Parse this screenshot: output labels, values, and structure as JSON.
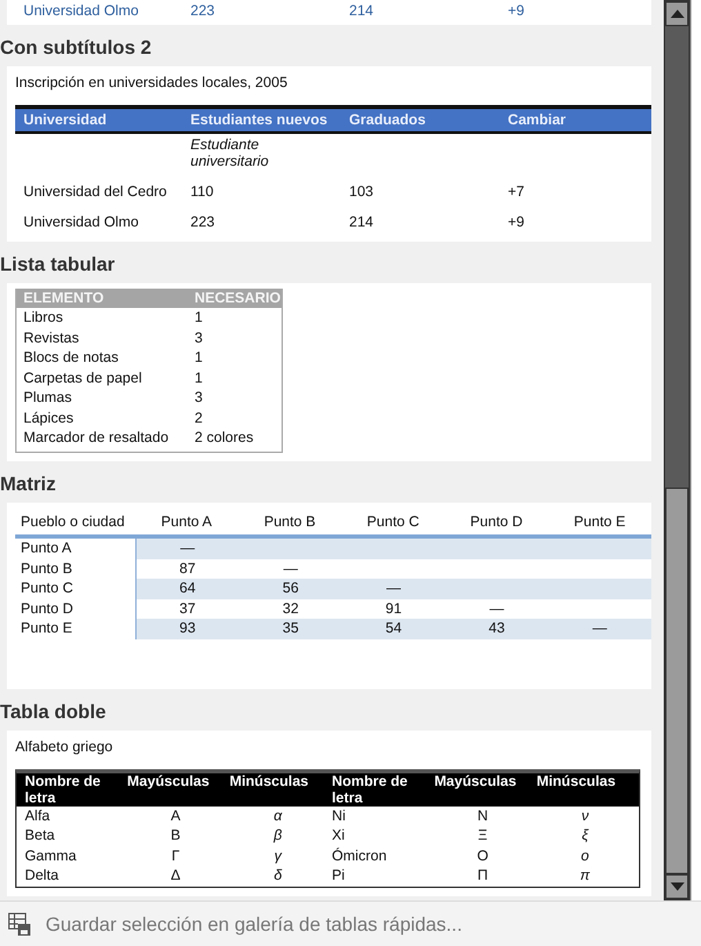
{
  "top_table": {
    "row": [
      "Universidad Olmo",
      "223",
      "214",
      "+9"
    ]
  },
  "sections": [
    {
      "kind": "subtitles",
      "heading": "Con subtítulos 2",
      "caption": "Inscripción en universidades locales, 2005",
      "columns": [
        "Universidad",
        "Estudiantes nuevos",
        "Graduados",
        "Cambiar"
      ],
      "subtitle": "Estudiante universitario",
      "rows": [
        [
          "Universidad del Cedro",
          "110",
          "103",
          "+7"
        ],
        [
          "Universidad Olmo",
          "223",
          "214",
          "+9"
        ]
      ]
    },
    {
      "kind": "list",
      "heading": "Lista tabular",
      "columns": [
        "ELEMENTO",
        "NECESARIO"
      ],
      "rows": [
        [
          "Libros",
          "1"
        ],
        [
          "Revistas",
          "3"
        ],
        [
          "Blocs de notas",
          "1"
        ],
        [
          "Carpetas de papel",
          "1"
        ],
        [
          "Plumas",
          "3"
        ],
        [
          "Lápices",
          "2"
        ],
        [
          "Marcador de resaltado",
          "2 colores"
        ]
      ]
    },
    {
      "kind": "matrix",
      "heading": "Matriz",
      "columns": [
        "Pueblo o ciudad",
        "Punto A",
        "Punto B",
        "Punto C",
        "Punto D",
        "Punto E"
      ],
      "rows": [
        [
          "Punto A",
          "—",
          "",
          "",
          "",
          ""
        ],
        [
          "Punto B",
          "87",
          "—",
          "",
          "",
          ""
        ],
        [
          "Punto C",
          "64",
          "56",
          "—",
          "",
          ""
        ],
        [
          "Punto D",
          "37",
          "32",
          "91",
          "—",
          ""
        ],
        [
          "Punto E",
          "93",
          "35",
          "54",
          "43",
          "—"
        ]
      ]
    },
    {
      "kind": "double",
      "heading": "Tabla doble",
      "caption": "Alfabeto griego",
      "columns": [
        "Nombre de letra",
        "Mayúsculas",
        "Minúsculas",
        "Nombre de letra",
        "Mayúsculas",
        "Minúsculas"
      ],
      "rows": [
        [
          "Alfa",
          "Α",
          "α",
          "Ni",
          "Ν",
          "ν"
        ],
        [
          "Beta",
          "Β",
          "β",
          "Xi",
          "Ξ",
          "ξ"
        ],
        [
          "Gamma",
          "Γ",
          "γ",
          "Ómicron",
          "Ο",
          "ο"
        ],
        [
          "Delta",
          "Δ",
          "δ",
          "Pi",
          "Π",
          "π"
        ]
      ]
    }
  ],
  "footer": {
    "label": "Guardar selección en galería de tablas rápidas..."
  }
}
